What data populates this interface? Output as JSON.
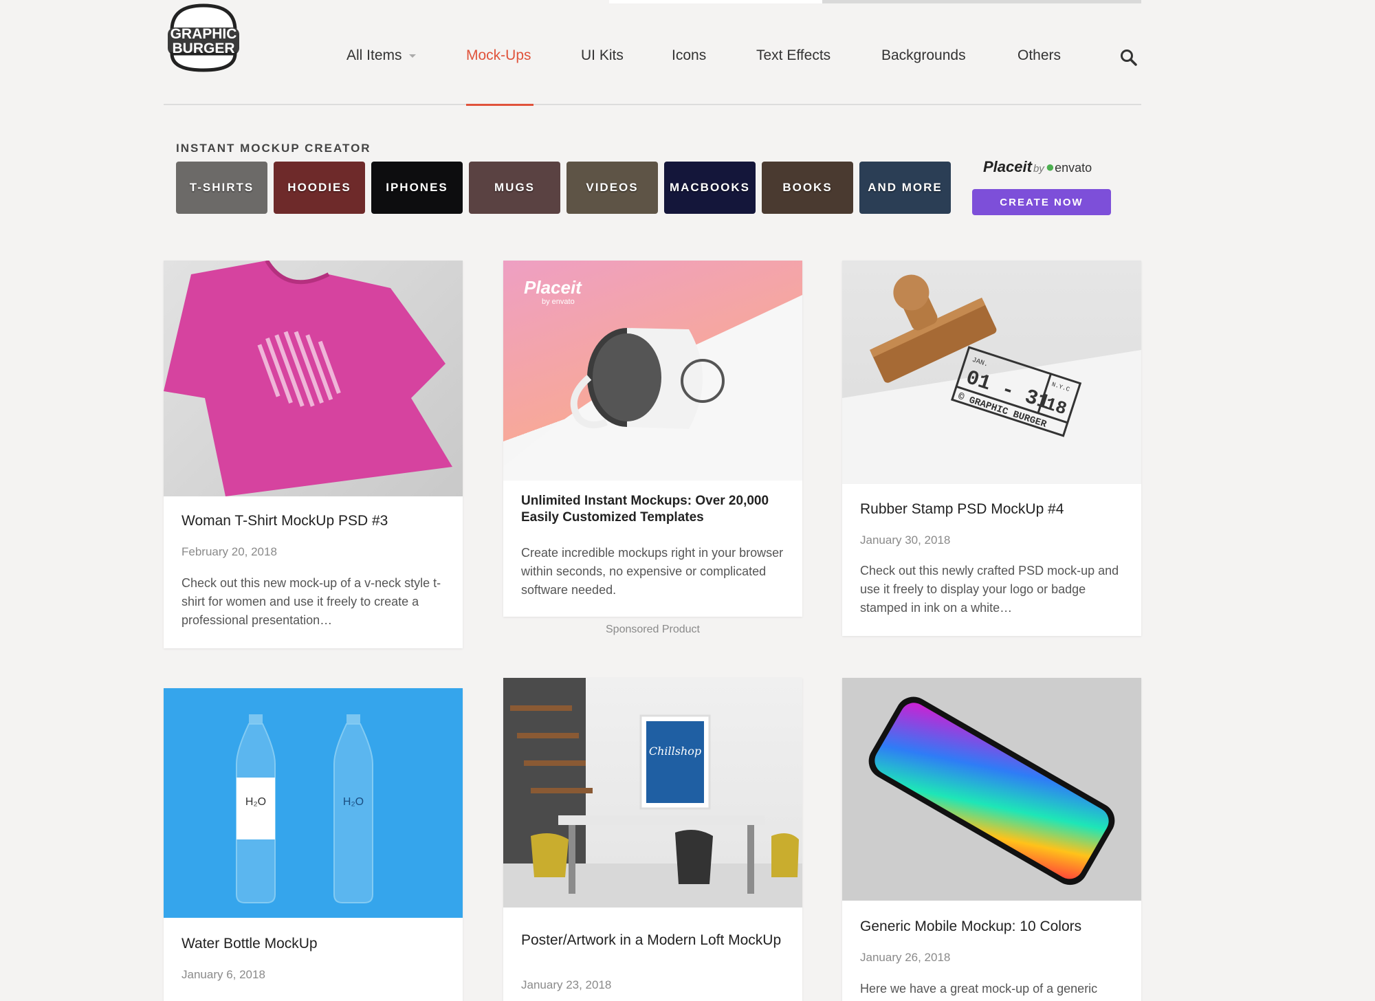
{
  "logo": {
    "line1": "GRAPHIC",
    "line2": "BURGER"
  },
  "nav": {
    "items": [
      {
        "label": "All Items",
        "active": false
      },
      {
        "label": "Mock-Ups",
        "active": true
      },
      {
        "label": "UI Kits",
        "active": false
      },
      {
        "label": "Icons",
        "active": false
      },
      {
        "label": "Text Effects",
        "active": false
      },
      {
        "label": "Backgrounds",
        "active": false
      },
      {
        "label": "Others",
        "active": false
      }
    ],
    "accent": "#e0533b"
  },
  "mockup_creator": {
    "title": "INSTANT MOCKUP CREATOR",
    "tiles": [
      {
        "label": "T-SHIRTS",
        "color": "#6c6a68"
      },
      {
        "label": "HOODIES",
        "color": "#6e2a2a"
      },
      {
        "label": "IPHONES",
        "color": "#0d0d0f"
      },
      {
        "label": "MUGS",
        "color": "#5a4242"
      },
      {
        "label": "VIDEOS",
        "color": "#5e5446"
      },
      {
        "label": "MACBOOKS",
        "color": "#14163a"
      },
      {
        "label": "BOOKS",
        "color": "#4a3a30"
      },
      {
        "label": "AND MORE",
        "color": "#2b3e55"
      }
    ],
    "placeit_brand": "Placeit",
    "placeit_by": "by",
    "placeit_envato": "envato",
    "cta": "CREATE NOW",
    "cta_color": "#7d4fd9"
  },
  "cards": [
    {
      "title": "Woman T-Shirt MockUp PSD #3",
      "date": "February 20, 2018",
      "desc": "Check out this new mock-up of a v-neck style t-shirt for women and use it freely to create a professional presentation…"
    },
    {
      "title": "Unlimited Instant Mockups: Over 20,000 Easily Customized Templates",
      "desc": "Create incredible mockups right in your browser within seconds, no expensive or complicated software needed.",
      "image_brand": "Placeit",
      "image_brand_sub": "by envato",
      "sponsored": "Sponsored Product"
    },
    {
      "title": "Rubber Stamp PSD MockUp #4",
      "date": "January 30, 2018",
      "desc": "Check out this newly crafted PSD mock-up and use it freely to display your logo or badge stamped in ink on a white…",
      "stamp_month": "JAN.",
      "stamp_days": "01 - 31",
      "stamp_city": "N.Y.C",
      "stamp_year": "18",
      "stamp_brand": "© GRAPHIC BURGER"
    },
    {
      "title": "Water Bottle MockUp",
      "date": "January 6, 2018",
      "label": "H₂O"
    },
    {
      "title": "Poster/Artwork in a Modern Loft MockUp",
      "date": "January 23, 2018",
      "poster_text": "Chillshop"
    },
    {
      "title": "Generic Mobile Mockup: 10 Colors",
      "date": "January 26, 2018",
      "desc": "Here we have a great mock-up of a generic"
    }
  ]
}
